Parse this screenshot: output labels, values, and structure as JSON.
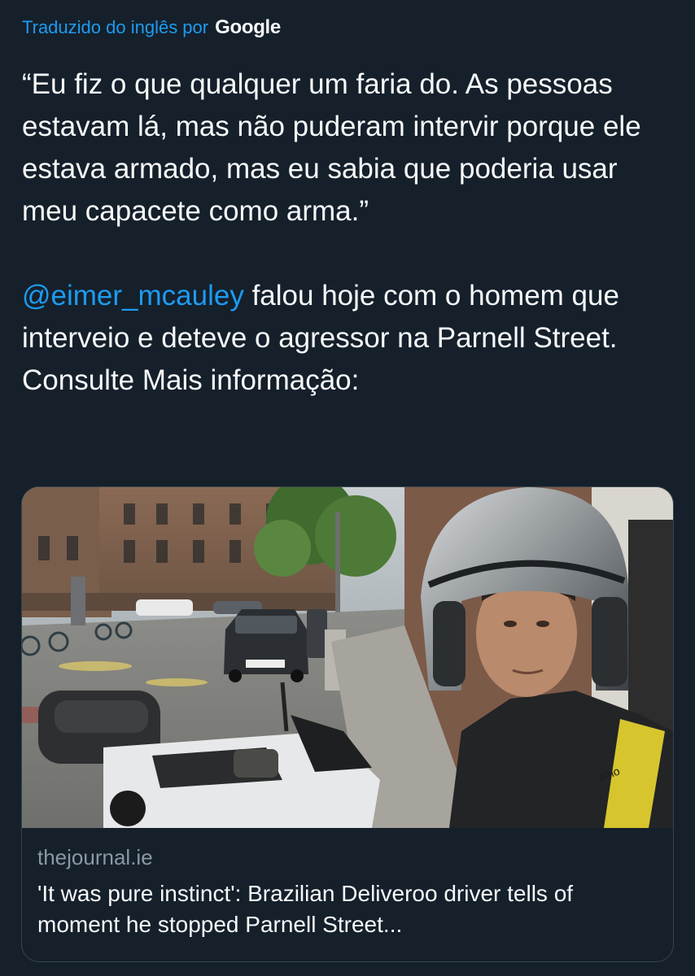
{
  "translation": {
    "prefix": "Traduzido do inglês por",
    "provider": "Google"
  },
  "tweet": {
    "quote": "“Eu fiz o que qualquer um faria do. As pessoas estavam lá, mas não puderam intervir porque ele estava armado, mas eu sabia que poderia usar meu capacete como arma.”",
    "mention": "@eimer_mcauley",
    "body": " falou hoje com o homem que interveio e deteve o agressor na Parnell Street. Consulte Mais informação:"
  },
  "link_card": {
    "domain": "thejournal.ie",
    "headline": "'It was pure instinct': Brazilian Deliveroo driver tells of moment he stopped Parnell Street...",
    "image_description_icon": "photo-selfie-helmet",
    "helmet_logo_text": "amo"
  },
  "colors": {
    "background": "#15202b",
    "accent": "#1d9bf0",
    "text": "#f7f9f9",
    "secondary": "#8b98a5",
    "border": "#38444d"
  }
}
